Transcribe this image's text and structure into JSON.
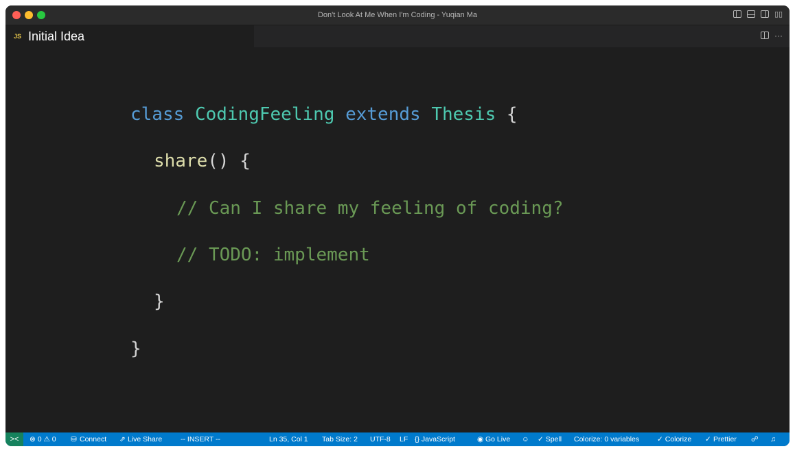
{
  "window": {
    "title": "Don't Look At Me When I'm Coding - Yuqian Ma"
  },
  "tab": {
    "icon": "JS",
    "label": "Initial Idea"
  },
  "code": {
    "line1": {
      "kw1": "class",
      "name": "CodingFeeling",
      "kw2": "extends",
      "parent": "Thesis",
      "brace": "{"
    },
    "line2": {
      "fn": "share",
      "parens": "()",
      "brace": "{"
    },
    "line3": "// Can I share my feeling of coding?",
    "line4": "// TODO: implement",
    "line5": "}",
    "line6": "}"
  },
  "statusbar": {
    "remote_icon": "><",
    "problems": "⊗ 0 ⚠ 0",
    "connect": "Connect",
    "live_share": "Live Share",
    "mode": "-- INSERT --",
    "position": "Ln 35, Col 1",
    "tab_size": "Tab Size: 2",
    "encoding": "UTF-8",
    "eol": "LF",
    "language": "{} JavaScript",
    "go_live": "Go Live",
    "spell": "✓ Spell",
    "colorize_vars": "Colorize: 0 variables",
    "colorize": "✓ Colorize",
    "prettier": "Prettier"
  },
  "colors": {
    "editor_bg": "#1e1e1e",
    "statusbar_bg": "#007acc",
    "keyword": "#569cd6",
    "class_name": "#4ec9b0",
    "function": "#dcdcaa",
    "comment": "#6a9955"
  },
  "icons": {
    "layout": [
      "toggle-sidebar-icon",
      "toggle-panel-icon",
      "toggle-secondary-sidebar-icon",
      "customize-layout-icon"
    ],
    "tab_actions": [
      "split-editor-icon",
      "more-actions-icon"
    ],
    "status": [
      "remote-icon",
      "database-icon",
      "live-share-icon",
      "broadcast-icon",
      "copilot-icon",
      "feedback-icon",
      "bell-icon"
    ]
  }
}
